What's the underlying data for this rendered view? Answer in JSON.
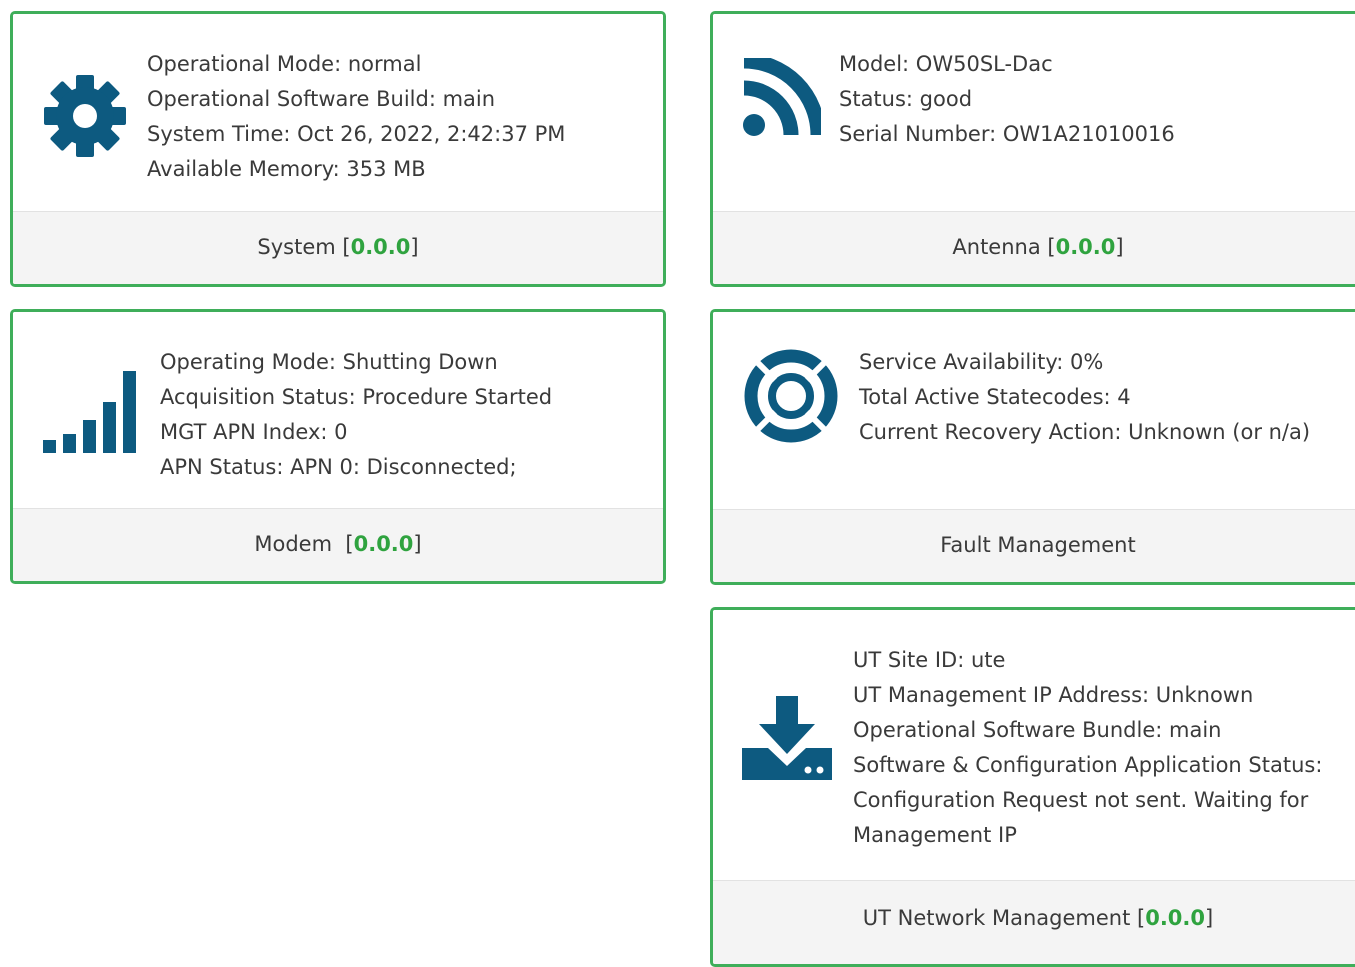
{
  "accent_color": "#3fae5a",
  "version_color": "#2fa33f",
  "icon_color": "#0d5a80",
  "system": {
    "icon": "gear-icon",
    "lines": [
      "Operational Mode: normal",
      "Operational Software Build: main",
      "System Time: Oct 26, 2022, 2:42:37 PM",
      "Available Memory: 353 MB"
    ],
    "footer_label": "System",
    "version": "0.0.0"
  },
  "antenna": {
    "icon": "rss-feed-icon",
    "lines": [
      "Model: OW50SL-Dac",
      "Status: good",
      "Serial Number: OW1A21010016"
    ],
    "footer_label": "Antenna",
    "version": "0.0.0"
  },
  "modem": {
    "icon": "signal-bars-icon",
    "lines": [
      "Operating Mode: Shutting Down",
      "Acquisition Status: Procedure Started",
      "MGT APN Index: 0",
      "APN Status: APN 0: Disconnected;"
    ],
    "footer_label": "Modem",
    "version": "0.0.0"
  },
  "fault": {
    "icon": "life-ring-icon",
    "lines": [
      "Service Availability: 0%",
      "Total Active Statecodes: 4",
      "Current Recovery Action: Unknown (or n/a)"
    ],
    "footer_label": "Fault Management"
  },
  "ut_network": {
    "icon": "download-icon",
    "lines": [
      "UT Site ID: ute",
      "UT Management IP Address: Unknown",
      "Operational Software Bundle: main",
      "Software & Configuration Application Status:",
      "Configuration Request not sent. Waiting for",
      "Management IP"
    ],
    "footer_label": "UT Network Management",
    "version": "0.0.0"
  }
}
